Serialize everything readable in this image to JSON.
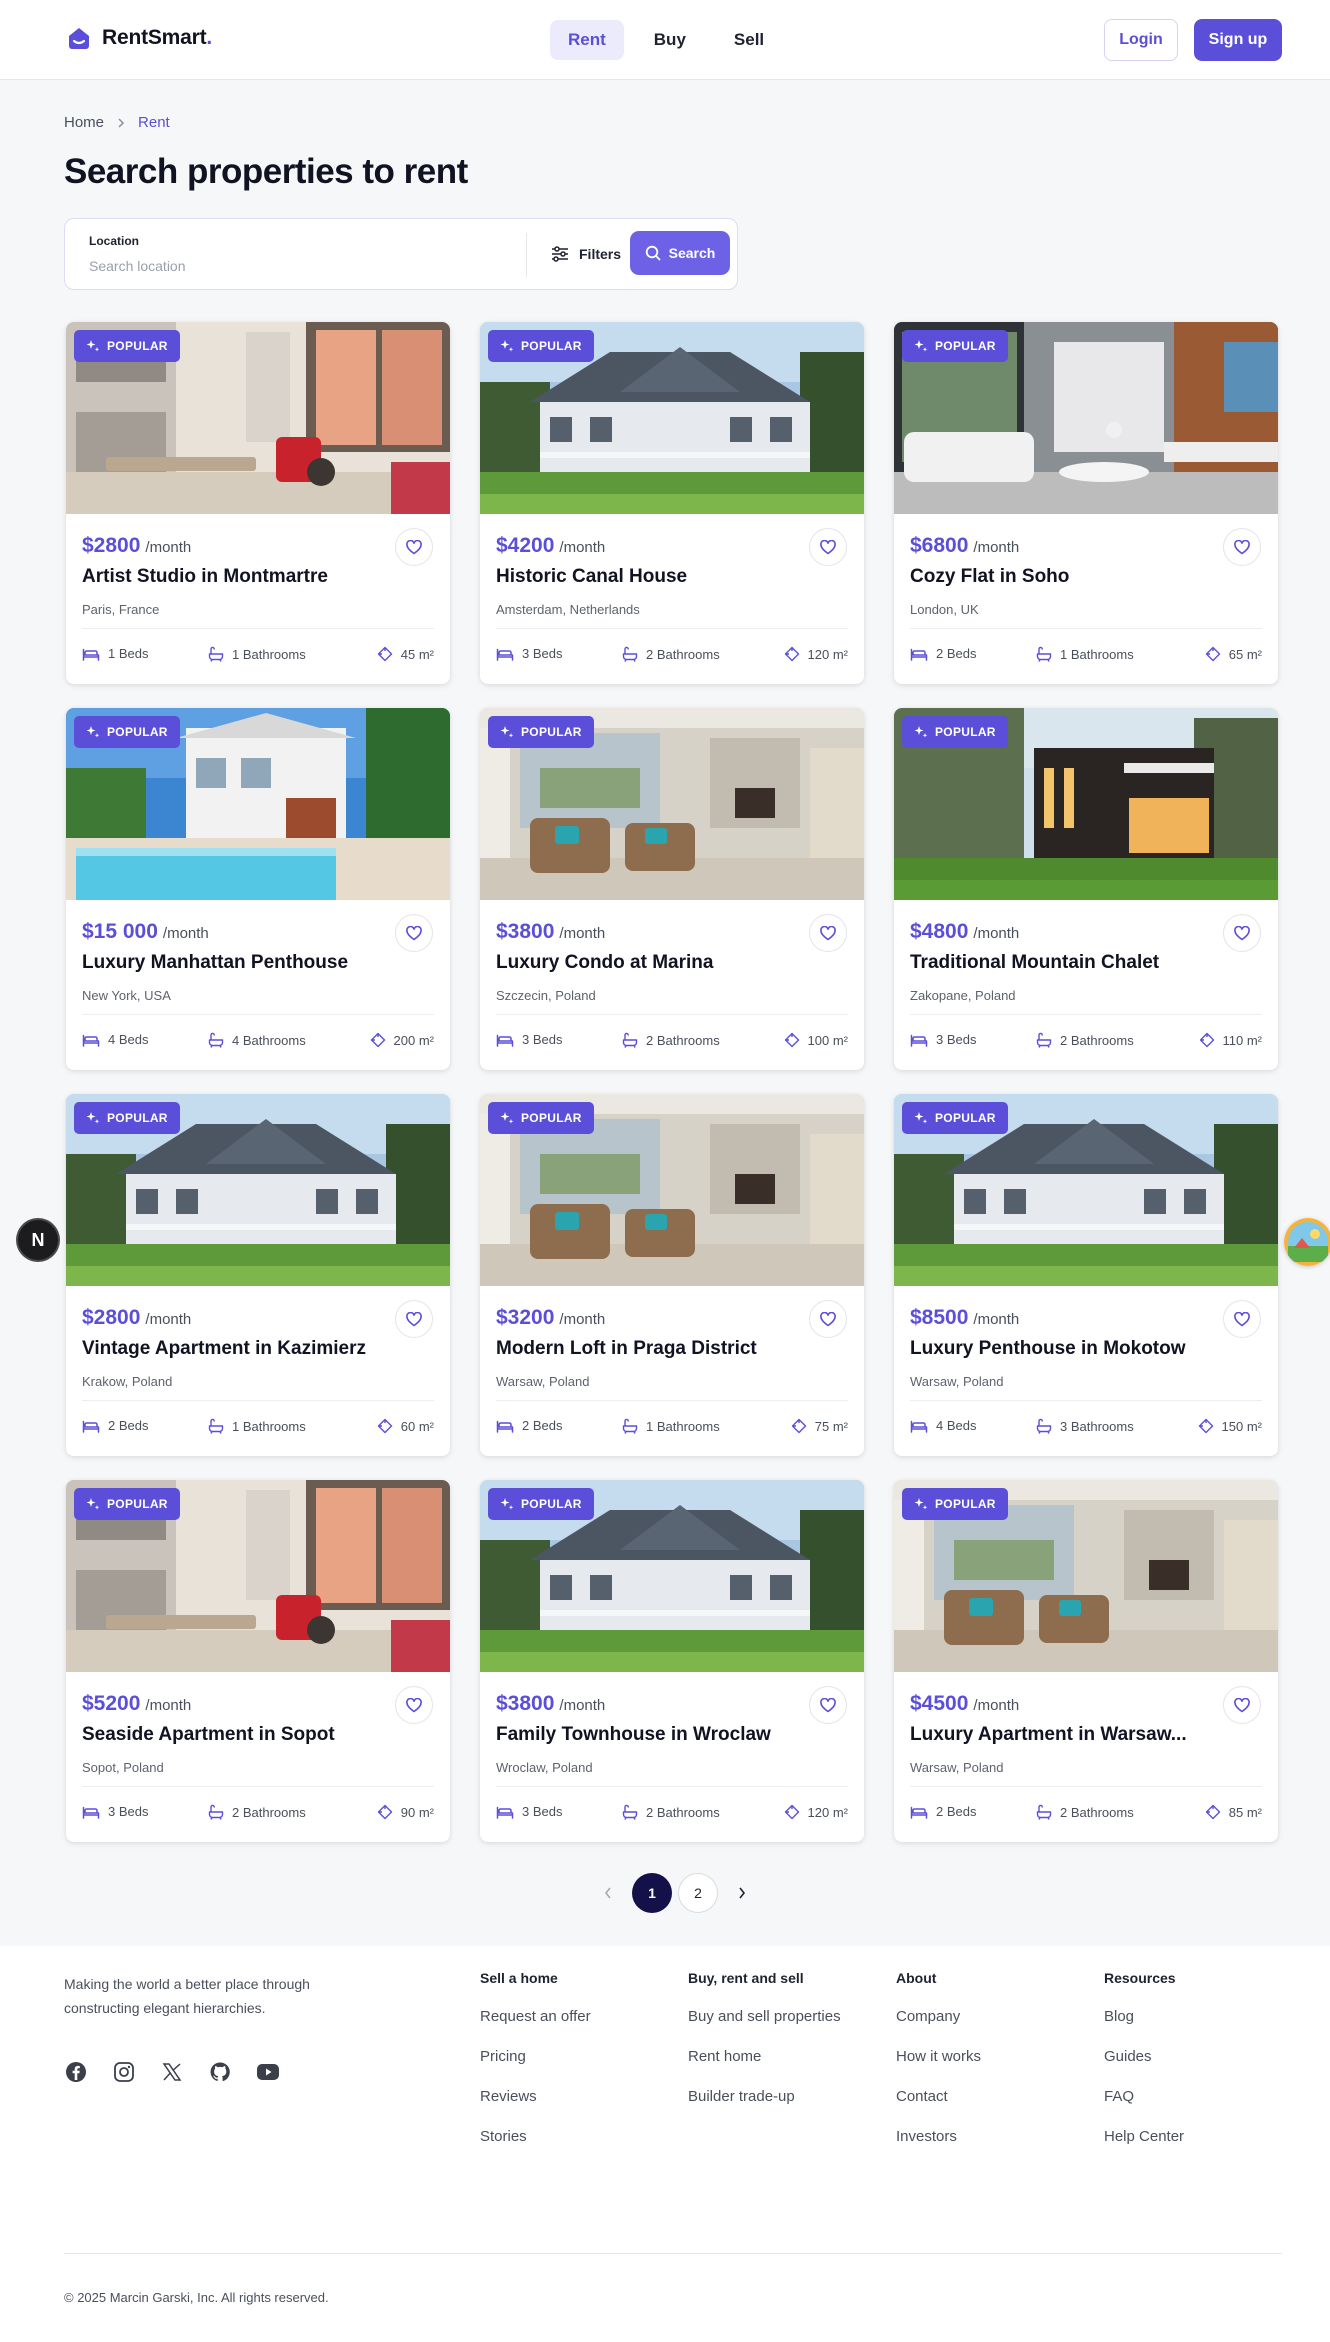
{
  "header": {
    "brand": "RentSmart",
    "brand_dot": ".",
    "nav": [
      {
        "label": "Rent",
        "active": true
      },
      {
        "label": "Buy",
        "active": false
      },
      {
        "label": "Sell",
        "active": false
      }
    ],
    "login_label": "Login",
    "signup_label": "Sign up"
  },
  "breadcrumb": {
    "home": "Home",
    "current": "Rent"
  },
  "page_title": "Search properties to rent",
  "search": {
    "location_label": "Location",
    "location_placeholder": "Search location",
    "filters_label": "Filters",
    "search_label": "Search"
  },
  "listings": [
    {
      "badge": "POPULAR",
      "price": "$2800",
      "period": "/month",
      "title": "Artist Studio in Montmartre",
      "location": "Paris, France",
      "beds": "1 Beds",
      "baths": "1 Bathrooms",
      "area": "45 m²",
      "photo": "interior-kitchen"
    },
    {
      "badge": "POPULAR",
      "price": "$4200",
      "period": "/month",
      "title": "Historic Canal House",
      "location": "Amsterdam, Netherlands",
      "beds": "3 Beds",
      "baths": "2 Bathrooms",
      "area": "120 m²",
      "photo": "house-porch"
    },
    {
      "badge": "POPULAR",
      "price": "$6800",
      "period": "/month",
      "title": "Cozy Flat in Soho",
      "location": "London, UK",
      "beds": "2 Beds",
      "baths": "1 Bathrooms",
      "area": "65 m²",
      "photo": "modern-living"
    },
    {
      "badge": "POPULAR",
      "price": "$15 000",
      "period": "/month",
      "title": "Luxury Manhattan Penthouse",
      "location": "New York, USA",
      "beds": "4 Beds",
      "baths": "4 Bathrooms",
      "area": "200 m²",
      "photo": "villa-pool"
    },
    {
      "badge": "POPULAR",
      "price": "$3800",
      "period": "/month",
      "title": "Luxury Condo at Marina",
      "location": "Szczecin, Poland",
      "beds": "3 Beds",
      "baths": "2 Bathrooms",
      "area": "100 m²",
      "photo": "living-sofas"
    },
    {
      "badge": "POPULAR",
      "price": "$4800",
      "period": "/month",
      "title": "Traditional Mountain Chalet",
      "location": "Zakopane, Poland",
      "beds": "3 Beds",
      "baths": "2 Bathrooms",
      "area": "110 m²",
      "photo": "modern-house-night"
    },
    {
      "badge": "POPULAR",
      "price": "$2800",
      "period": "/month",
      "title": "Vintage Apartment in Kazimierz",
      "location": "Krakow, Poland",
      "beds": "2 Beds",
      "baths": "1 Bathrooms",
      "area": "60 m²",
      "photo": "house-porch"
    },
    {
      "badge": "POPULAR",
      "price": "$3200",
      "period": "/month",
      "title": "Modern Loft in Praga District",
      "location": "Warsaw, Poland",
      "beds": "2 Beds",
      "baths": "1 Bathrooms",
      "area": "75 m²",
      "photo": "living-sofas"
    },
    {
      "badge": "POPULAR",
      "price": "$8500",
      "period": "/month",
      "title": "Luxury Penthouse in Mokotow",
      "location": "Warsaw, Poland",
      "beds": "4 Beds",
      "baths": "3 Bathrooms",
      "area": "150 m²",
      "photo": "house-porch"
    },
    {
      "badge": "POPULAR",
      "price": "$5200",
      "period": "/month",
      "title": "Seaside Apartment in Sopot",
      "location": "Sopot, Poland",
      "beds": "3 Beds",
      "baths": "2 Bathrooms",
      "area": "90 m²",
      "photo": "interior-kitchen"
    },
    {
      "badge": "POPULAR",
      "price": "$3800",
      "period": "/month",
      "title": "Family Townhouse in Wroclaw",
      "location": "Wroclaw, Poland",
      "beds": "3 Beds",
      "baths": "2 Bathrooms",
      "area": "120 m²",
      "photo": "house-porch"
    },
    {
      "badge": "POPULAR",
      "price": "$4500",
      "period": "/month",
      "title": "Luxury Apartment in Warsaw...",
      "location": "Warsaw, Poland",
      "beds": "2 Beds",
      "baths": "2 Bathrooms",
      "area": "85 m²",
      "photo": "living-sofas"
    }
  ],
  "pagination": {
    "pages": [
      "1",
      "2"
    ],
    "current": "1"
  },
  "side": {
    "next_badge": "N"
  },
  "footer": {
    "tagline": "Making the world a better place through constructing elegant hierarchies.",
    "socials": [
      "facebook-icon",
      "instagram-icon",
      "x-icon",
      "github-icon",
      "youtube-icon"
    ],
    "columns": [
      {
        "title": "Sell a home",
        "links": [
          "Request an offer",
          "Pricing",
          "Reviews",
          "Stories"
        ]
      },
      {
        "title": "Buy, rent and sell",
        "links": [
          "Buy and sell properties",
          "Rent home",
          "Builder trade-up"
        ]
      },
      {
        "title": "About",
        "links": [
          "Company",
          "How it works",
          "Contact",
          "Investors"
        ]
      },
      {
        "title": "Resources",
        "links": [
          "Blog",
          "Guides",
          "FAQ",
          "Help Center"
        ]
      }
    ],
    "copyright": "© 2025 Marcin Garski, Inc. All rights reserved."
  },
  "colors": {
    "accent": "#5b4fd9",
    "page_bg": "#f6f7f9",
    "pagination_active": "#14104a"
  }
}
